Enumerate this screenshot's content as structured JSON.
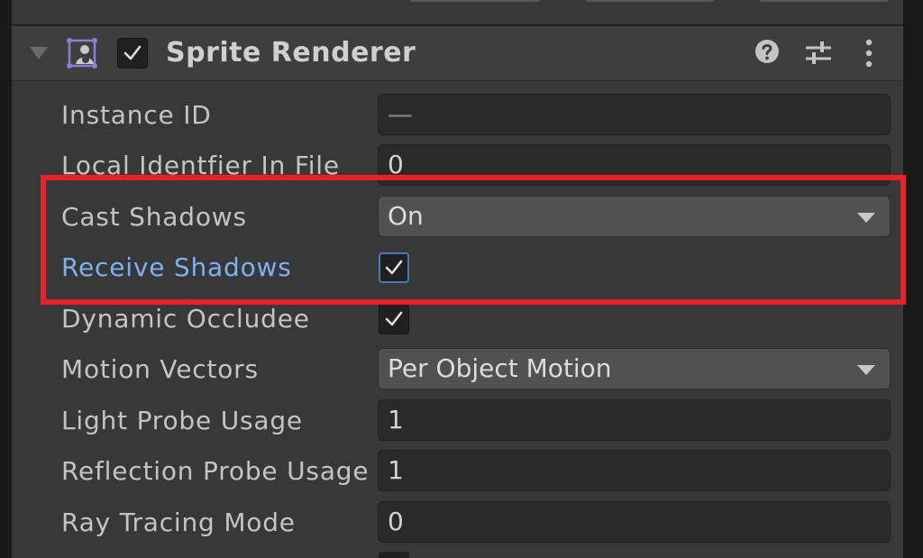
{
  "component": {
    "title": "Sprite Renderer",
    "enabled": true
  },
  "header_icons": [
    "sprite-renderer-icon",
    "help-icon",
    "preset-icon",
    "more-menu-icon"
  ],
  "properties": {
    "instance_id": {
      "label": "Instance ID",
      "value": "—"
    },
    "local_identifier": {
      "label": "Local Identfier In File",
      "value": "0"
    },
    "cast_shadows": {
      "label": "Cast Shadows",
      "value": "On"
    },
    "receive_shadows": {
      "label": "Receive Shadows",
      "checked": true
    },
    "dynamic_occludee": {
      "label": "Dynamic Occludee",
      "checked": true
    },
    "motion_vectors": {
      "label": "Motion Vectors",
      "value": "Per Object Motion"
    },
    "light_probe_usage": {
      "label": "Light Probe Usage",
      "value": "1"
    },
    "reflection_probe_usage": {
      "label": "Reflection Probe Usage",
      "value": "1"
    },
    "ray_tracing_mode": {
      "label": "Ray Tracing Mode",
      "value": "0"
    }
  },
  "colors": {
    "highlight_border": "#e8202a",
    "highlighted_label": "#7fb0f0",
    "focus_outline": "#4a7ab5",
    "panel_background": "#383838"
  }
}
